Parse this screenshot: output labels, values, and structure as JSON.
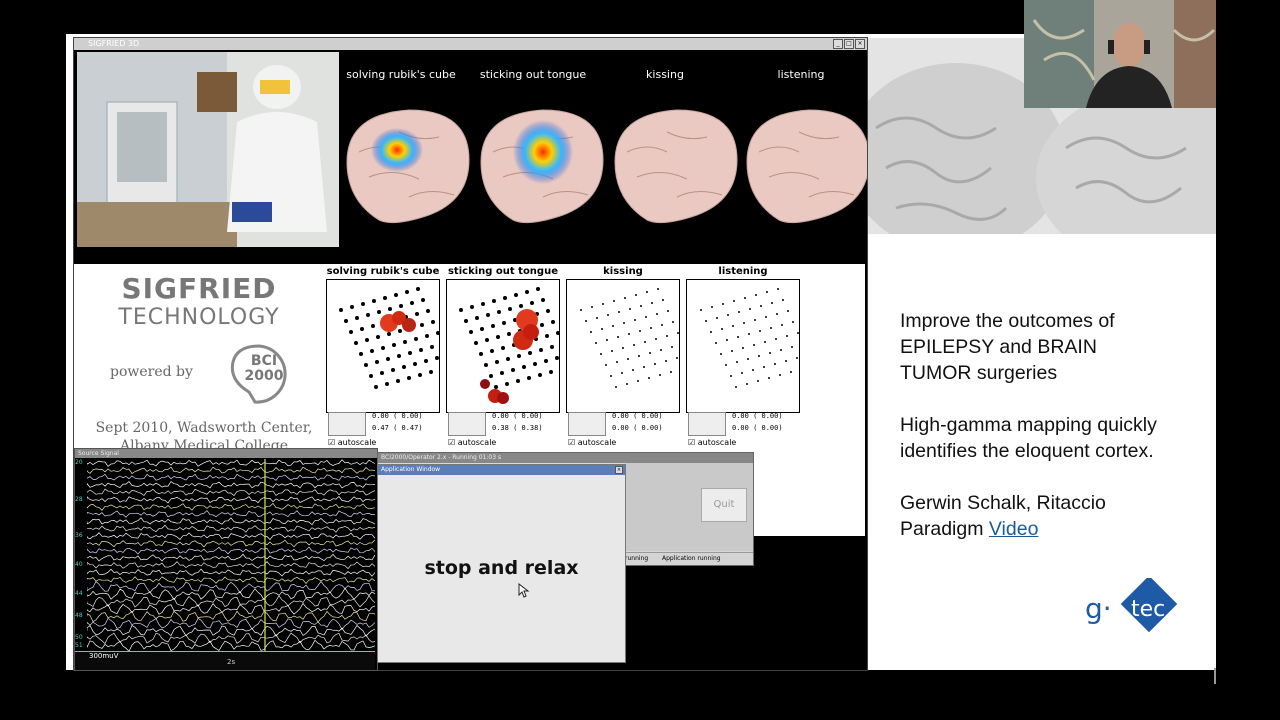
{
  "sigwin": {
    "title": "SIGFRIED 3D"
  },
  "brains": [
    {
      "label": "solving rubik's cube"
    },
    {
      "label": "sticking out tongue"
    },
    {
      "label": "kissing"
    },
    {
      "label": "listening"
    }
  ],
  "logo": {
    "line1": "SIGFRIED",
    "line2": "TECHNOLOGY",
    "powered": "powered by",
    "badge1": "BCI",
    "badge2": "2000",
    "place1": "Sept 2010, Wadsworth Center,",
    "place2": "Albany Medical College"
  },
  "grids": [
    {
      "title": "solving rubik's cube",
      "r1": "0.00 ( 0.00)",
      "r2": "0.47 ( 0.47)",
      "auto": "autoscale"
    },
    {
      "title": "sticking out tongue",
      "r1": "0.00 ( 0.00)",
      "r2": "0.38 ( 0.38)",
      "auto": "autoscale"
    },
    {
      "title": "kissing",
      "r1": "0.00 ( 0.00)",
      "r2": "0.00 ( 0.00)",
      "auto": "autoscale"
    },
    {
      "title": "listening",
      "r1": "0.00 ( 0.00)",
      "r2": "0.00 ( 0.00)",
      "auto": "autoscale"
    }
  ],
  "signal": {
    "title": "Source Signal",
    "scale": "300muV",
    "time": "2s",
    "channels": [
      "20",
      "",
      "",
      "",
      "",
      "28",
      "",
      "",
      "",
      "",
      "36",
      "",
      "",
      "",
      "40",
      "",
      "",
      "",
      "44",
      "",
      "",
      "48",
      "",
      "",
      "50",
      "51"
    ]
  },
  "operator": {
    "title": "BCI2000/Operator 2.x - Running 01:03 s",
    "status1": "running",
    "status2": "Application running",
    "quit": "Quit"
  },
  "appwin": {
    "title": "Application Window",
    "message": "stop and relax"
  },
  "slide": {
    "p1": "Improve the outcomes of EPILEPSY and BRAIN TUMOR surgeries",
    "p2": "High-gamma mapping quickly identifies the eloquent cortex.",
    "p3a": "Gerwin Schalk, Ritaccio",
    "p3b": "Paradigm",
    "link": "Video"
  },
  "brand": {
    "logo": "g.tec",
    "accent": "#1f5aa6"
  }
}
